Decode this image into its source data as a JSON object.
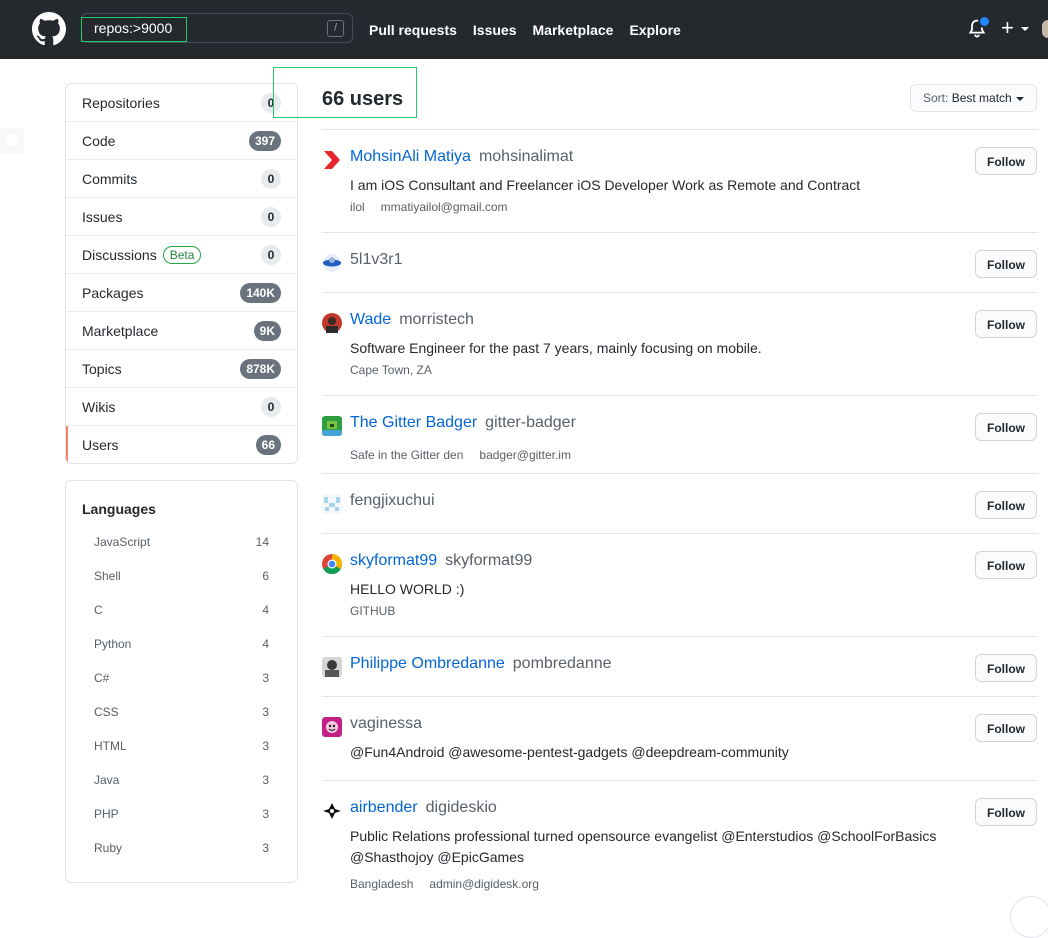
{
  "header": {
    "search_value": "repos:>9000",
    "search_key_hint": "/",
    "nav": [
      "Pull requests",
      "Issues",
      "Marketplace",
      "Explore"
    ],
    "plus_label": "+"
  },
  "sidebar": {
    "items": [
      {
        "label": "Repositories",
        "count": "0",
        "style": "light"
      },
      {
        "label": "Code",
        "count": "397",
        "style": "dark"
      },
      {
        "label": "Commits",
        "count": "0",
        "style": "light"
      },
      {
        "label": "Issues",
        "count": "0",
        "style": "light"
      },
      {
        "label": "Discussions",
        "badge": "Beta",
        "count": "0",
        "style": "light"
      },
      {
        "label": "Packages",
        "count": "140K",
        "style": "dark"
      },
      {
        "label": "Marketplace",
        "count": "9K",
        "style": "dark"
      },
      {
        "label": "Topics",
        "count": "878K",
        "style": "dark"
      },
      {
        "label": "Wikis",
        "count": "0",
        "style": "light"
      },
      {
        "label": "Users",
        "count": "66",
        "style": "dark",
        "selected": true
      }
    ],
    "languages": {
      "title": "Languages",
      "items": [
        {
          "name": "JavaScript",
          "count": "14"
        },
        {
          "name": "Shell",
          "count": "6"
        },
        {
          "name": "C",
          "count": "4"
        },
        {
          "name": "Python",
          "count": "4"
        },
        {
          "name": "C#",
          "count": "3"
        },
        {
          "name": "CSS",
          "count": "3"
        },
        {
          "name": "HTML",
          "count": "3"
        },
        {
          "name": "Java",
          "count": "3"
        },
        {
          "name": "PHP",
          "count": "3"
        },
        {
          "name": "Ruby",
          "count": "3"
        }
      ]
    }
  },
  "results": {
    "title": "66 users",
    "sort_prefix": "Sort:",
    "sort_value": "Best match",
    "follow_label": "Follow",
    "users": [
      {
        "name": "MohsinAli Matiya",
        "login": "mohsinalimat",
        "bio": "I am iOS Consultant and Freelancer iOS Developer Work as Remote and Contract",
        "meta": [
          "ilol",
          "mmatiyailol@gmail.com"
        ],
        "avatar": "red-chevron"
      },
      {
        "name": "",
        "login": "5l1v3r1",
        "bio": "",
        "meta": [],
        "avatar": "blue-disc"
      },
      {
        "name": "Wade",
        "login": "morristech",
        "bio": "Software Engineer for the past 7 years, mainly focusing on mobile.",
        "meta": [
          "Cape Town, ZA"
        ],
        "avatar": "photo-red"
      },
      {
        "name": "The Gitter Badger",
        "login": "gitter-badger",
        "bio": "",
        "meta": [
          "Safe in the Gitter den",
          "badger@gitter.im"
        ],
        "avatar": "green-pixel"
      },
      {
        "name": "",
        "login": "fengjixuchui",
        "bio": "",
        "meta": [],
        "avatar": "pale-blue-identicon"
      },
      {
        "name": "skyformat99",
        "login": "skyformat99",
        "bio": "HELLO WORLD :)",
        "meta": [
          "GITHUB"
        ],
        "avatar": "chrome-circle"
      },
      {
        "name": "Philippe Ombredanne",
        "login": "pombredanne",
        "bio": "",
        "meta": [],
        "avatar": "photo-dark"
      },
      {
        "name": "",
        "login": "vaginessa",
        "bio": "@Fun4Android @awesome-pentest-gadgets @deepdream-community",
        "meta": [],
        "avatar": "magenta-face"
      },
      {
        "name": "airbender",
        "login": "digideskio",
        "bio": "Public Relations professional turned opensource evangelist @Enterstudios @SchoolForBasics @Shasthojoy @EpicGames",
        "meta": [
          "Bangladesh",
          "admin@digidesk.org"
        ],
        "avatar": "black-emblem"
      }
    ]
  }
}
